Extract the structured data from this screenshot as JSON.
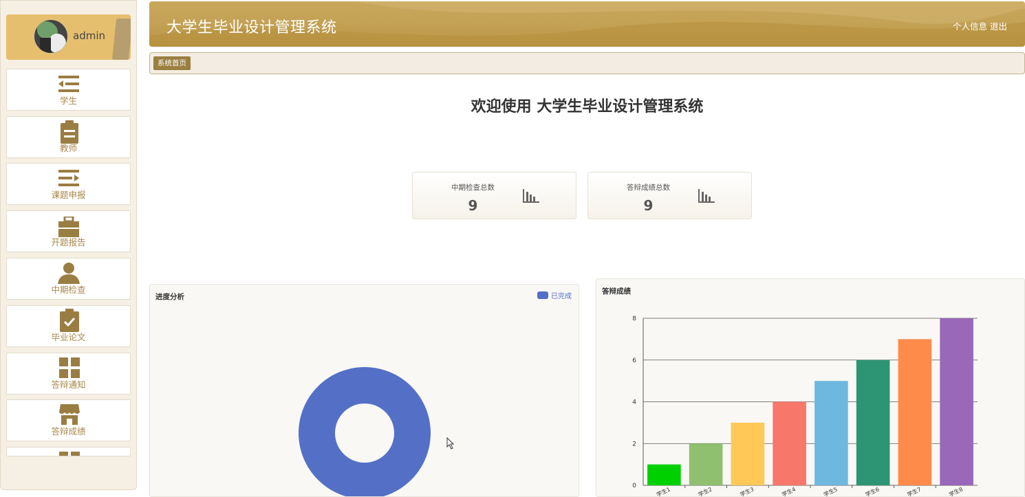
{
  "sidebar": {
    "user": {
      "name": "admin"
    },
    "items": [
      {
        "label": "学生",
        "icon": "list-indent-icon"
      },
      {
        "label": "教师",
        "icon": "clipboard-icon"
      },
      {
        "label": "课题申报",
        "icon": "list-arrow-icon"
      },
      {
        "label": "开题报告",
        "icon": "briefcase-icon"
      },
      {
        "label": "中期检查",
        "icon": "user-icon"
      },
      {
        "label": "毕业论文",
        "icon": "clipboard-check-icon"
      },
      {
        "label": "答辩通知",
        "icon": "grid-icon"
      },
      {
        "label": "答辩成绩",
        "icon": "store-icon"
      }
    ]
  },
  "header": {
    "title": "大学生毕业设计管理系统",
    "profile_link": "个人信息",
    "logout_link": "退出"
  },
  "breadcrumb": {
    "home": "系统首页"
  },
  "welcome": "欢迎使用 大学生毕业设计管理系统",
  "stats": [
    {
      "label": "中期检查总数",
      "value": "9",
      "icon": "bar-chart-icon"
    },
    {
      "label": "答辩成绩总数",
      "value": "9",
      "icon": "bar-chart-icon"
    }
  ],
  "colors": {
    "accent": "#c3a155",
    "menu_text": "#a8884a",
    "donut": "#5470c6"
  },
  "chart_data": [
    {
      "type": "pie",
      "title": "进度分析",
      "legend": "top-right",
      "series": [
        {
          "name": "已完成",
          "values": [
            1
          ]
        }
      ],
      "categories": [
        "已完成"
      ],
      "donut": true
    },
    {
      "type": "bar",
      "title": "答辩成绩",
      "ylim": [
        0,
        8
      ],
      "yticks": [
        0,
        2,
        4,
        6,
        8
      ],
      "grid": true,
      "categories": [
        "学生1",
        "学生2",
        "学生3",
        "学生4",
        "学生5",
        "学生6",
        "学生7",
        "学生8"
      ],
      "values": [
        1,
        2,
        3,
        4,
        5,
        6,
        7,
        8
      ],
      "bar_colors": [
        "#00d000",
        "#8fc06f",
        "#ffc857",
        "#f8776b",
        "#6eb8e0",
        "#2e9574",
        "#ff8b4b",
        "#9a68b8"
      ]
    }
  ]
}
